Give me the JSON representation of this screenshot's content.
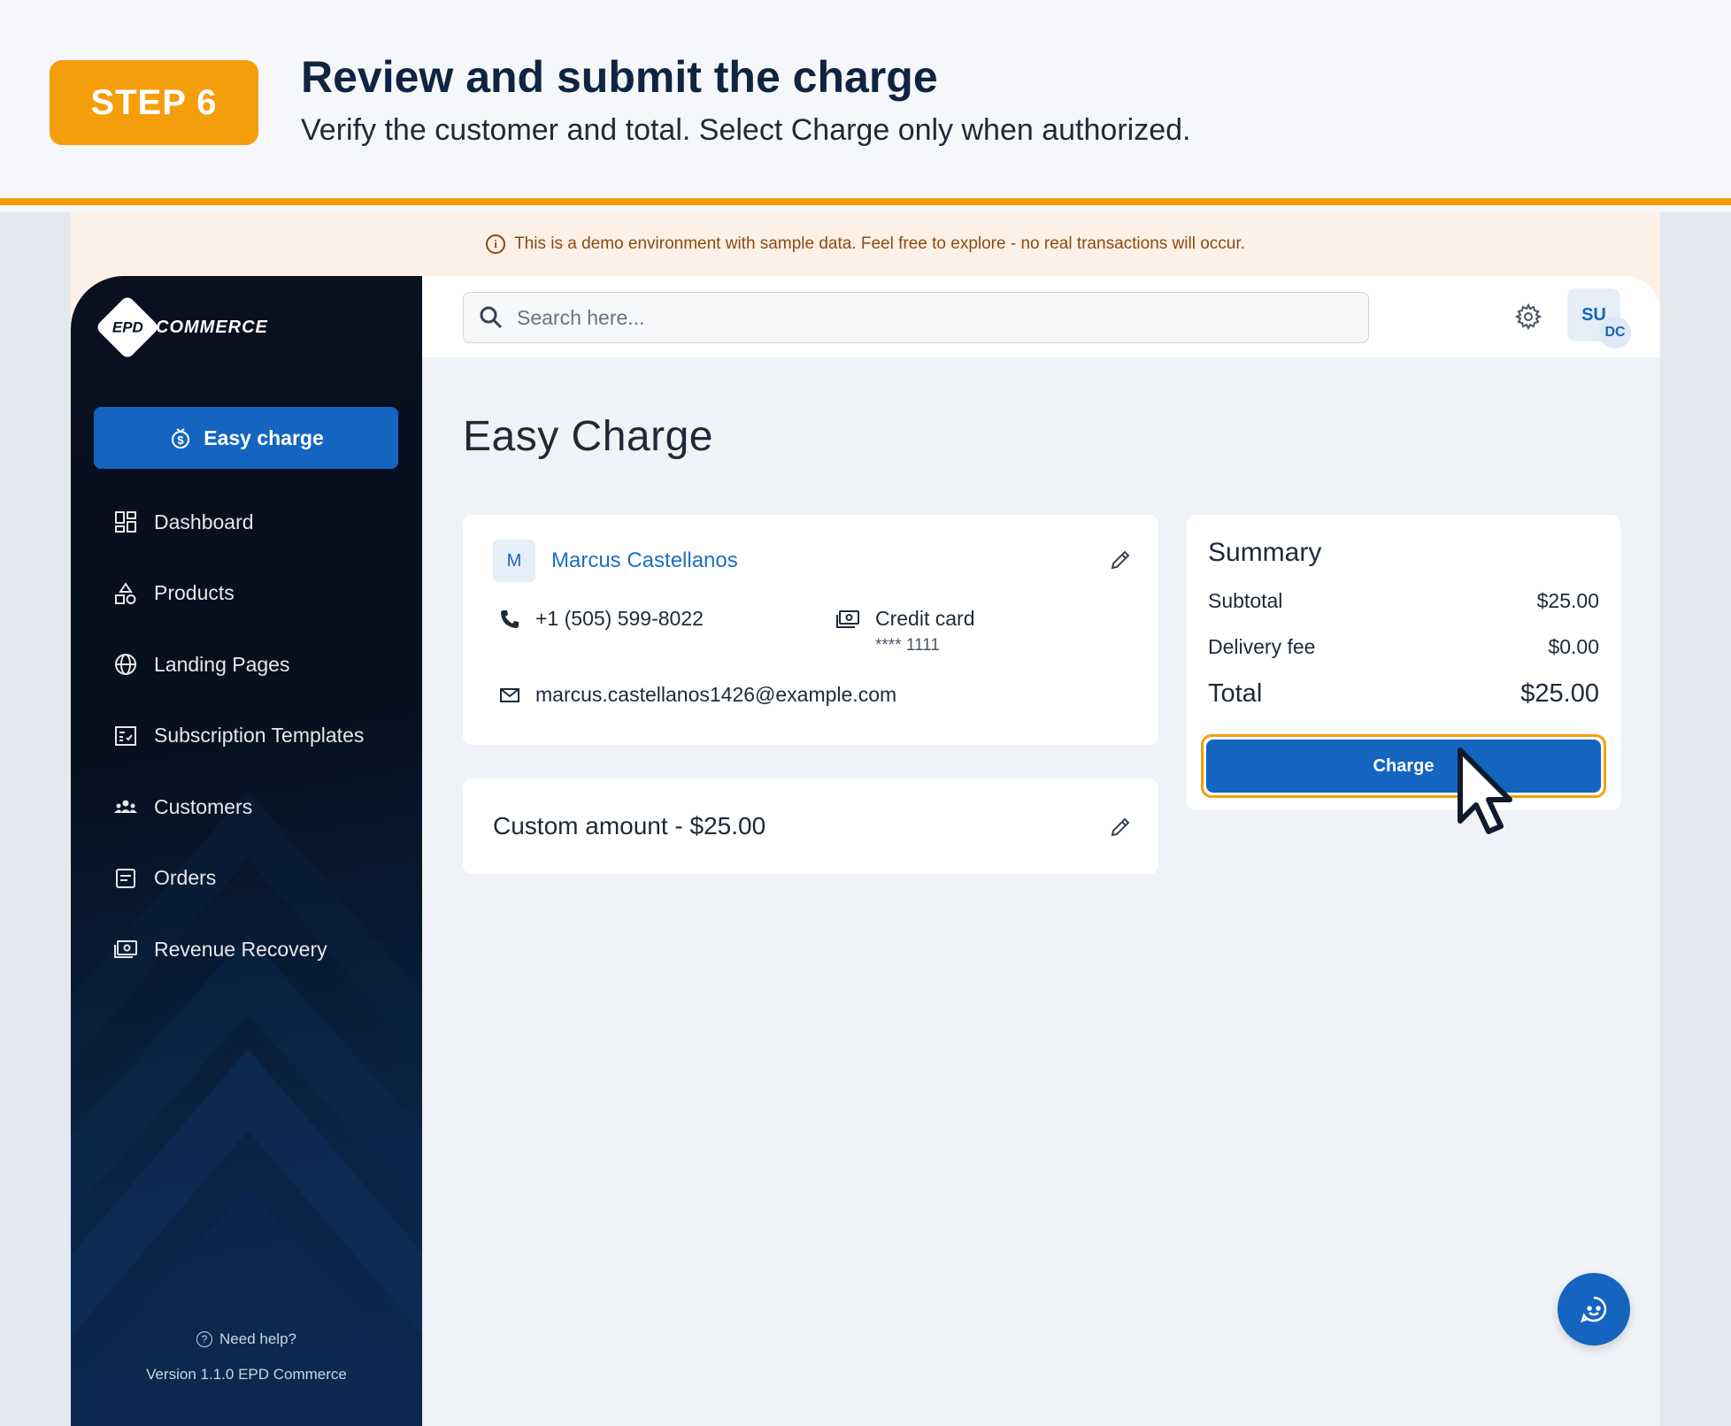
{
  "step": {
    "badge": "STEP 6",
    "title": "Review and submit the charge",
    "subtitle": "Verify the customer and total. Select Charge only when authorized."
  },
  "banner": {
    "text": "This is a demo environment with sample data. Feel free to explore - no real transactions will occur."
  },
  "sidebar": {
    "logo_mark": "EPD",
    "logo_text": "COMMERCE",
    "primary_button": "Easy charge",
    "items": [
      {
        "label": "Dashboard",
        "icon": "dashboard-icon"
      },
      {
        "label": "Products",
        "icon": "shapes-icon"
      },
      {
        "label": "Landing Pages",
        "icon": "globe-icon"
      },
      {
        "label": "Subscription Templates",
        "icon": "checklist-icon"
      },
      {
        "label": "Customers",
        "icon": "people-icon"
      },
      {
        "label": "Orders",
        "icon": "document-icon"
      },
      {
        "label": "Revenue Recovery",
        "icon": "money-icon"
      }
    ],
    "help": "Need help?",
    "version": "Version 1.1.0 EPD Commerce"
  },
  "topbar": {
    "search_placeholder": "Search here...",
    "avatar": "SU",
    "avatar_sub": "DC"
  },
  "page": {
    "title": "Easy Charge"
  },
  "customer": {
    "initial": "M",
    "name": "Marcus Castellanos",
    "phone": "+1 (505) 599-8022",
    "payment_method": "Credit card",
    "card_mask": "**** 1111",
    "email": "marcus.castellanos1426@example.com"
  },
  "amount": {
    "label": "Custom amount - $25.00"
  },
  "summary": {
    "title": "Summary",
    "subtotal_label": "Subtotal",
    "subtotal_value": "$25.00",
    "delivery_label": "Delivery fee",
    "delivery_value": "$0.00",
    "total_label": "Total",
    "total_value": "$25.00",
    "charge_label": "Charge"
  },
  "colors": {
    "accent": "#f59e0b",
    "primary": "#1565c0",
    "sidebar_bg": "#06101f"
  }
}
